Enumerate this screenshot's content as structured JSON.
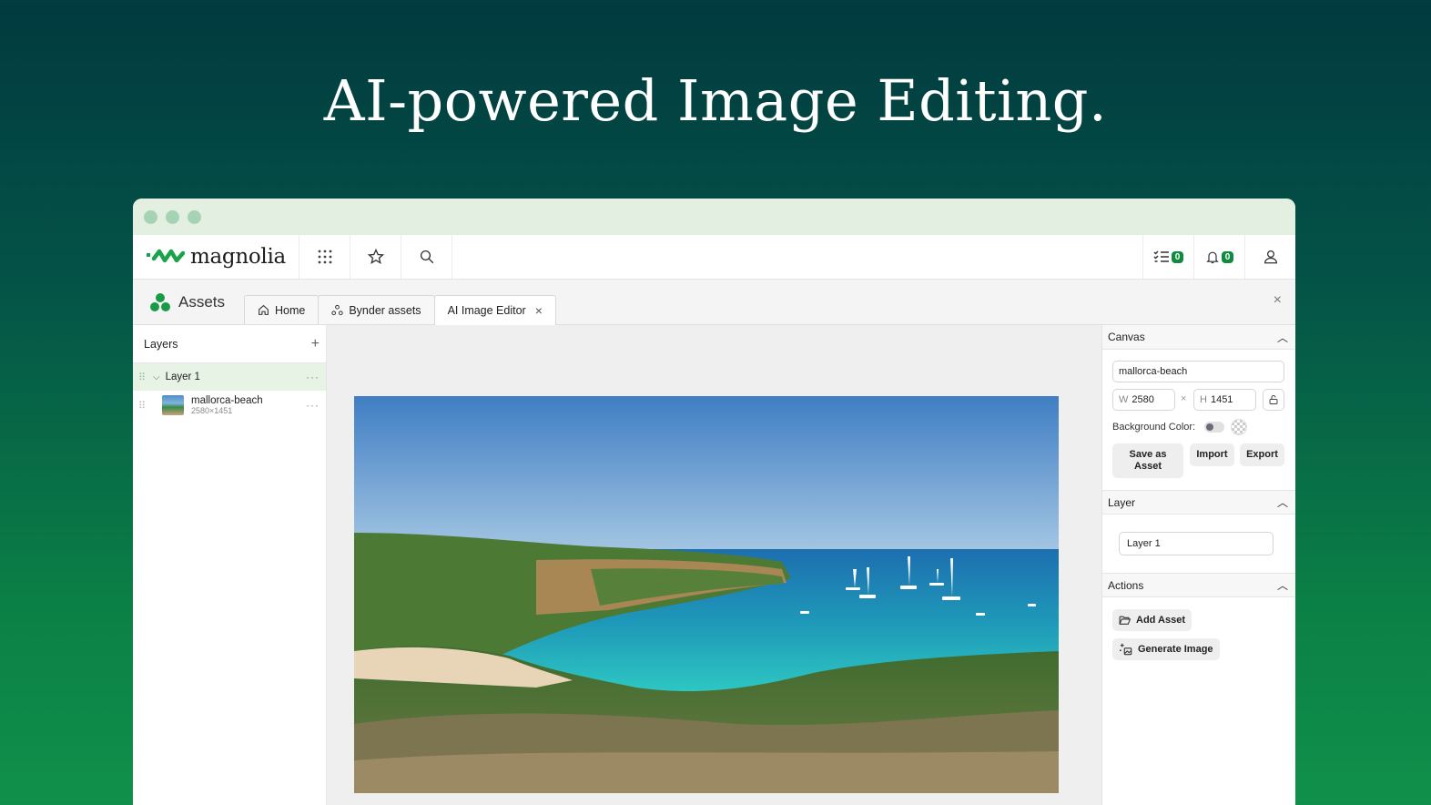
{
  "hero": {
    "title": "AI-powered Image Editing."
  },
  "app": {
    "logo_text": "magnolia",
    "tasks_count": "0",
    "notifications_count": "0"
  },
  "module": {
    "name": "Assets",
    "tabs": [
      {
        "label": "Home",
        "icon": "home-icon"
      },
      {
        "label": "Bynder assets",
        "icon": "bynder-icon"
      },
      {
        "label": "AI Image Editor",
        "icon": "close-icon",
        "active": true
      }
    ],
    "close_symbol": "×"
  },
  "layers": {
    "header": "Layers",
    "add_symbol": "+",
    "group": {
      "label": "Layer 1"
    },
    "items": [
      {
        "name": "mallorca-beach",
        "size": "2580×1451"
      }
    ]
  },
  "canvas_props": {
    "header": "Canvas",
    "name_value": "mallorca-beach",
    "width_label": "W",
    "width_value": "2580",
    "height_label": "H",
    "height_value": "1451",
    "times_symbol": "×",
    "background_label": "Background Color:",
    "save_label": "Save as Asset",
    "import_label": "Import",
    "export_label": "Export"
  },
  "layer_props": {
    "header": "Layer",
    "name_value": "Layer 1"
  },
  "actions": {
    "header": "Actions",
    "add_asset_label": "Add Asset",
    "generate_label": "Generate Image"
  },
  "colors": {
    "brand_green": "#0f8a3e",
    "selected_row": "#e6f3e5",
    "titlebar": "#e2efe1"
  }
}
